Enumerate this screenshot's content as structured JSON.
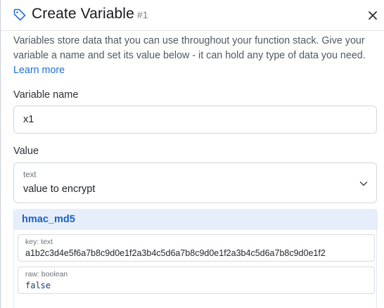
{
  "header": {
    "title": "Create Variable",
    "number": "#1",
    "icon": "tag-icon",
    "close_icon": "close-icon"
  },
  "description": {
    "text": "Variables store data that you can use throughout your function stack. Give your variable a name and set its value below - it can hold any type of data you need.",
    "link": "Learn more"
  },
  "form": {
    "name_label": "Variable name",
    "name_value": "x1",
    "value_label": "Value",
    "value_type": "text",
    "value_text": "value to encrypt"
  },
  "filter": {
    "name": "hmac_md5",
    "args": [
      {
        "label": "key: text",
        "value": "a1b2c3d4e5f6a7b8c9d0e1f2a3b4c5d6a7b8c9d0e1f2a3b4c5d6a7b8c9d0e1f2"
      },
      {
        "label": "raw: boolean",
        "value": "false"
      }
    ]
  },
  "colors": {
    "accent": "#1f6fd1",
    "filter_header_bg": "#e6eefb",
    "filter_name": "#1e5fbf"
  }
}
